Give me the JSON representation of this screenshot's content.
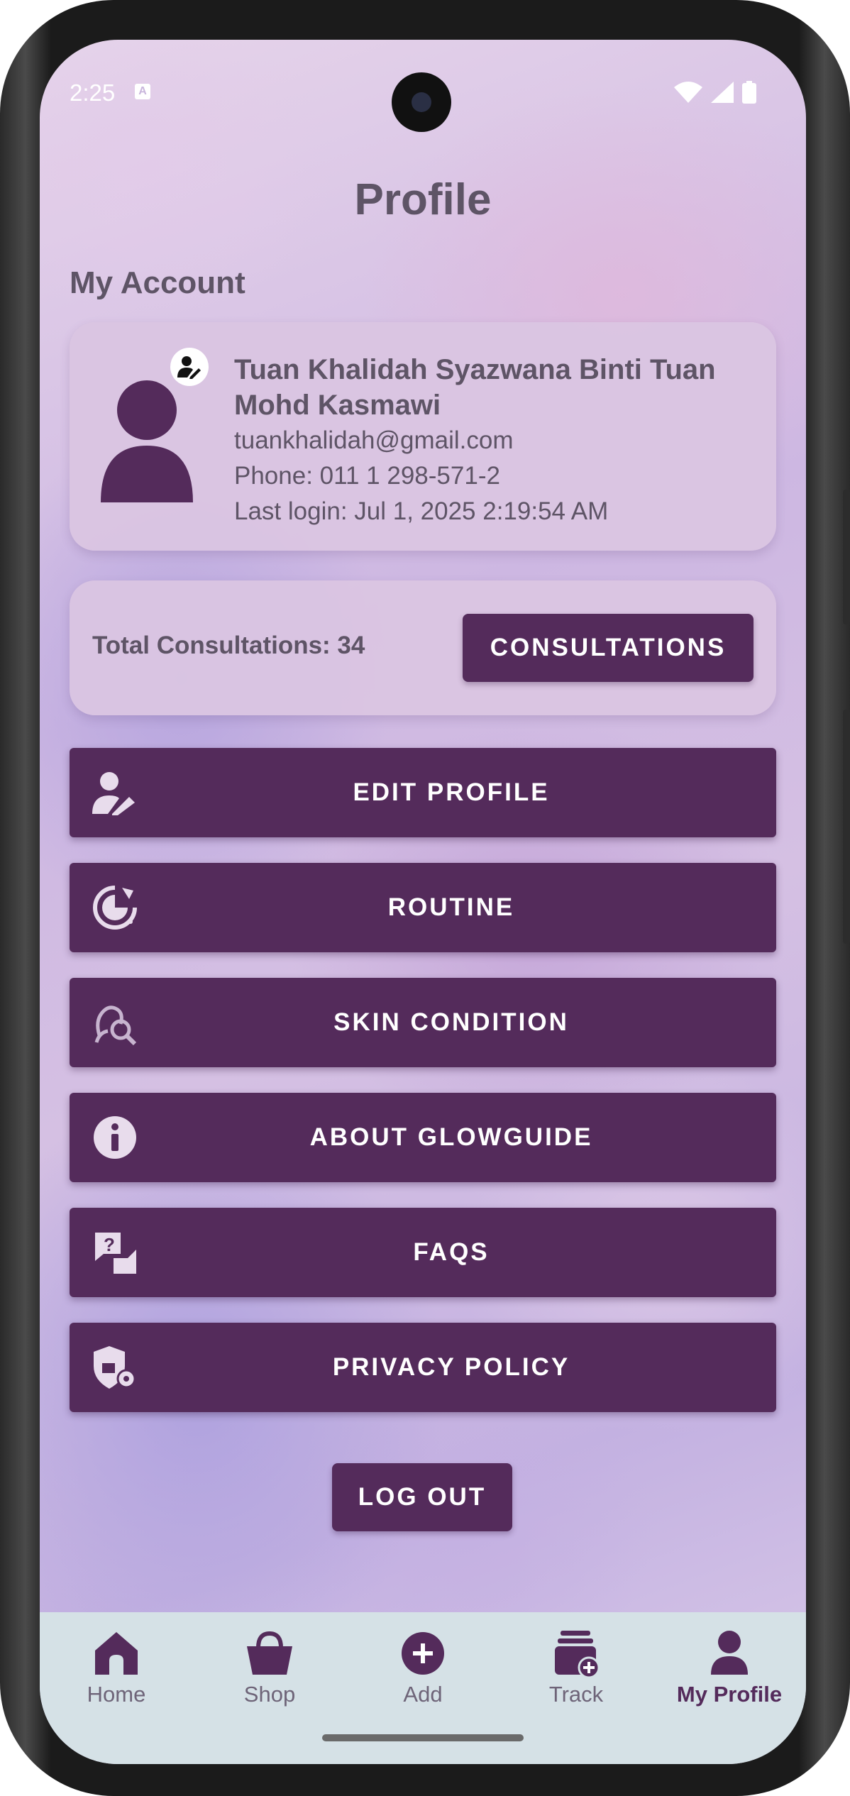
{
  "status_bar": {
    "time": "2:25"
  },
  "header": {
    "title": "Profile"
  },
  "account": {
    "section_title": "My Account",
    "name": "Tuan Khalidah Syazwana Binti Tuan Mohd Kasmawi",
    "email": "tuankhalidah@gmail.com",
    "phone": "Phone: 011 1 298-571-2",
    "last_login": "Last login: Jul 1, 2025 2:19:54 AM"
  },
  "consultations": {
    "total_label": "Total Consultations: 34",
    "button_label": "CONSULTATIONS"
  },
  "menu": [
    {
      "label": "EDIT PROFILE",
      "icon": "edit-profile-icon"
    },
    {
      "label": "ROUTINE",
      "icon": "routine-clock-icon"
    },
    {
      "label": "SKIN CONDITION",
      "icon": "skin-search-icon"
    },
    {
      "label": "ABOUT GLOWGUIDE",
      "icon": "info-icon"
    },
    {
      "label": "FAQS",
      "icon": "faq-chat-icon"
    },
    {
      "label": "PRIVACY POLICY",
      "icon": "shield-settings-icon"
    }
  ],
  "logout_label": "LOG OUT",
  "nav": [
    {
      "label": "Home",
      "icon": "home-icon"
    },
    {
      "label": "Shop",
      "icon": "shop-basket-icon"
    },
    {
      "label": "Add",
      "icon": "add-circle-icon"
    },
    {
      "label": "Track",
      "icon": "track-stack-icon"
    },
    {
      "label": "My Profile",
      "icon": "profile-icon",
      "active": true
    }
  ],
  "colors": {
    "primary": "#542b5b",
    "card": "#dac5e2",
    "text": "#5e5466",
    "nav_bg": "#d5e1e6"
  }
}
